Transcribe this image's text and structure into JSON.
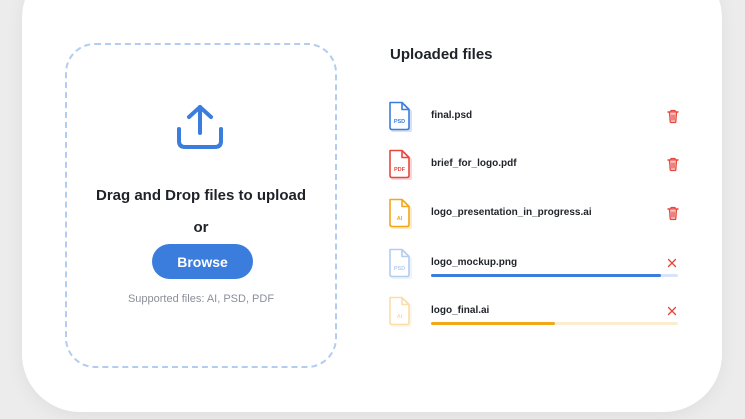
{
  "dropzone": {
    "title": "Drag and Drop files to upload",
    "or_label": "or",
    "browse_label": "Browse",
    "supported_text": "Supported files: AI, PSD, PDF"
  },
  "uploaded": {
    "title": "Uploaded files",
    "files": [
      {
        "name": "final.psd",
        "type": "PSD",
        "status": "complete",
        "color": "#3b7ddd"
      },
      {
        "name": "brief_for_logo.pdf",
        "type": "PDF",
        "status": "complete",
        "color": "#e8473f"
      },
      {
        "name": "logo_presentation_in_progress.ai",
        "type": "AI",
        "status": "complete",
        "color": "#f2a71b"
      },
      {
        "name": "logo_mockup.png",
        "type": "PSD",
        "status": "uploading",
        "progress": 0.93,
        "color": "#3b7ddd"
      },
      {
        "name": "logo_final.ai",
        "type": "AI",
        "status": "uploading",
        "progress": 0.5,
        "color": "#f2a71b"
      }
    ]
  },
  "icons": {
    "upload": "upload-arrow-icon",
    "delete": "trash-icon",
    "cancel": "close-icon",
    "file": "file-document-icon"
  },
  "colors": {
    "accent": "#3b7ddd",
    "danger": "#e8473f",
    "warning": "#f2a71b",
    "dashed_border": "#b3cdf0"
  }
}
